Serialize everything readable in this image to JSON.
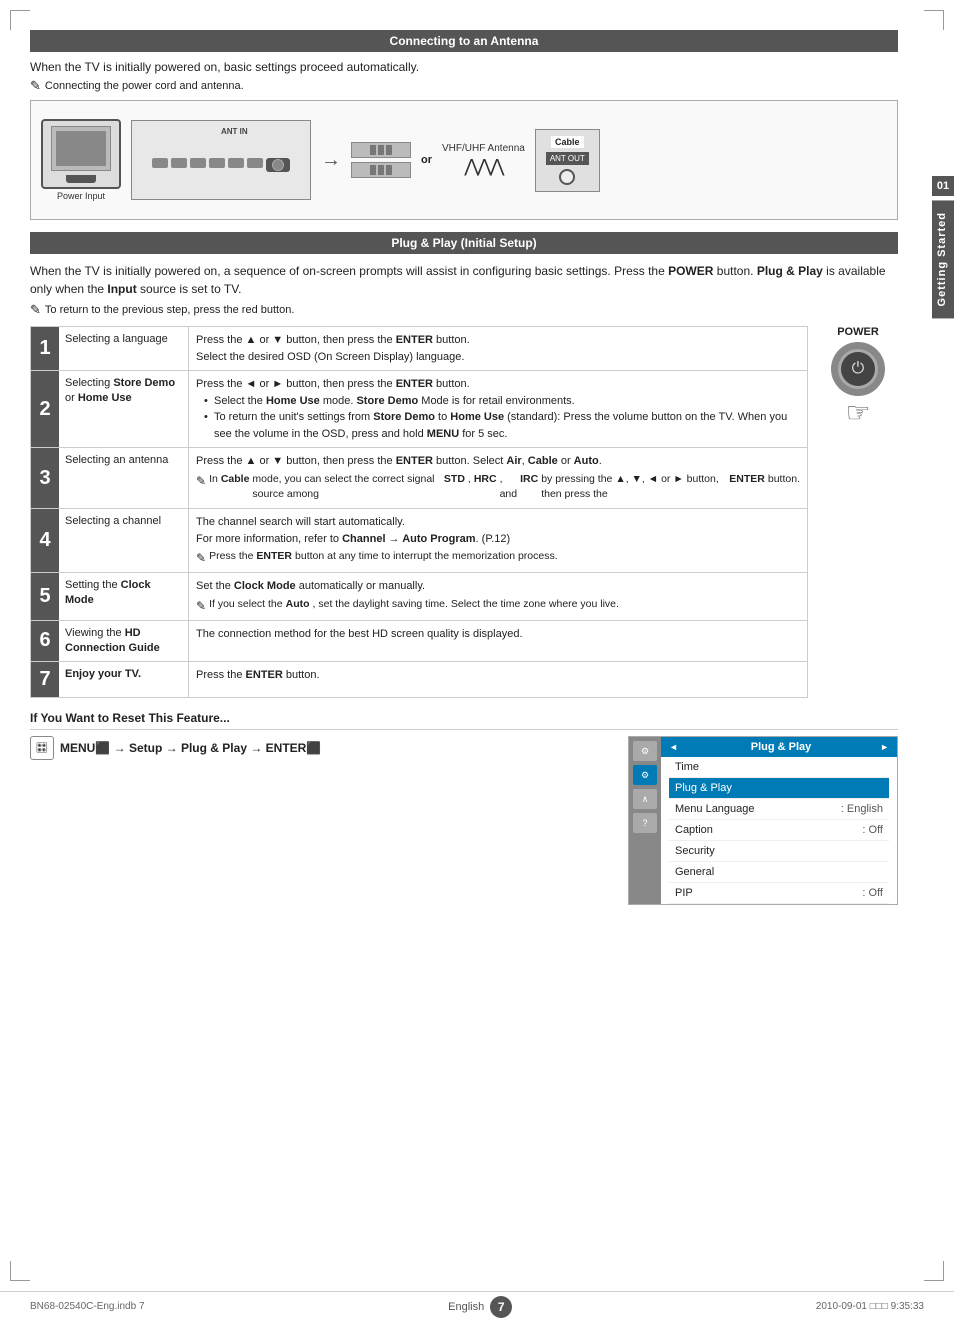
{
  "page": {
    "title": "Getting Started",
    "chapter": "01",
    "page_number": "7",
    "language": "English",
    "file_info": "BN68-02540C-Eng.indb   7",
    "date_info": "2010-09-01   □□□ 9:35:33"
  },
  "antenna_section": {
    "header": "Connecting to an Antenna",
    "intro": "When the TV is initially powered on, basic settings proceed automatically.",
    "note": "Connecting the power cord and antenna.",
    "diagram": {
      "power_input_label": "Power Input",
      "ant_in_label": "ANT IN",
      "vhf_uhf_label": "VHF/UHF Antenna",
      "or_text": "or",
      "cable_title": "Cable",
      "ant_out_label": "ANT OUT"
    }
  },
  "plugplay_section": {
    "header": "Plug & Play (Initial Setup)",
    "intro": "When the TV is initially powered on, a sequence of on-screen prompts will assist in configuring basic settings. Press the POWER button. Plug & Play is available only when the Input source is set to TV.",
    "note": "To return to the previous step, press the red button.",
    "power_label": "POWER",
    "steps": [
      {
        "num": "1",
        "title": "Selecting a language",
        "content": "Press the ▲ or ▼ button, then press the ENTER button.\nSelect the desired OSD (On Screen Display) language.",
        "note": null
      },
      {
        "num": "2",
        "title_plain": "Selecting ",
        "title_bold": "Store Demo",
        "title_plain2": " or ",
        "title_bold2": "Home Use",
        "content_main": "Press the ◄ or ► button, then press the ENTER button.",
        "bullets": [
          "Select the Home Use mode. Store Demo Mode is for retail environments.",
          "To return the unit's settings from Store Demo to Home Use (standard): Press the volume button on the TV. When you see the volume in the OSD, press and hold MENU for 5 sec."
        ],
        "note": null
      },
      {
        "num": "3",
        "title": "Selecting an antenna",
        "content": "Press the ▲ or ▼ button, then press the ENTER button. Select Air, Cable or Auto.",
        "note": "In Cable mode, you can select the correct signal source among STD, HRC, and IRC by pressing the ▲, ▼, ◄ or ► button, then press the ENTER button."
      },
      {
        "num": "4",
        "title": "Selecting a channel",
        "content": "The channel search will start automatically.\nFor more information, refer to Channel → Auto Program. (P.12)",
        "note": "Press the ENTER button at any time to interrupt the memorization process."
      },
      {
        "num": "5",
        "title_plain": "Setting the ",
        "title_bold": "Clock",
        "title_plain2": "\nMode",
        "content": "Set the Clock Mode automatically or manually.",
        "note": "If you select the Auto, set the daylight saving time. Select the time zone where you live."
      },
      {
        "num": "6",
        "title_plain": "Viewing the ",
        "title_bold": "HD\nConnection Guide",
        "content": "The connection method for the best HD screen quality is displayed.",
        "note": null
      },
      {
        "num": "7",
        "title": "Enjoy your TV.",
        "content": "Press the ENTER button.",
        "note": null
      }
    ]
  },
  "reset_section": {
    "title": "If You Want to Reset This Feature...",
    "path": "MENU → Setup → Plug & Play → ENTER",
    "menu": {
      "header": "Plug & Play",
      "items": [
        {
          "label": "Time",
          "value": ""
        },
        {
          "label": "Menu Language",
          "value": ": English"
        },
        {
          "label": "Caption",
          "value": ": Off"
        },
        {
          "label": "Security",
          "value": ""
        },
        {
          "label": "General",
          "value": ""
        },
        {
          "label": "PIP",
          "value": ": Off"
        }
      ]
    }
  }
}
